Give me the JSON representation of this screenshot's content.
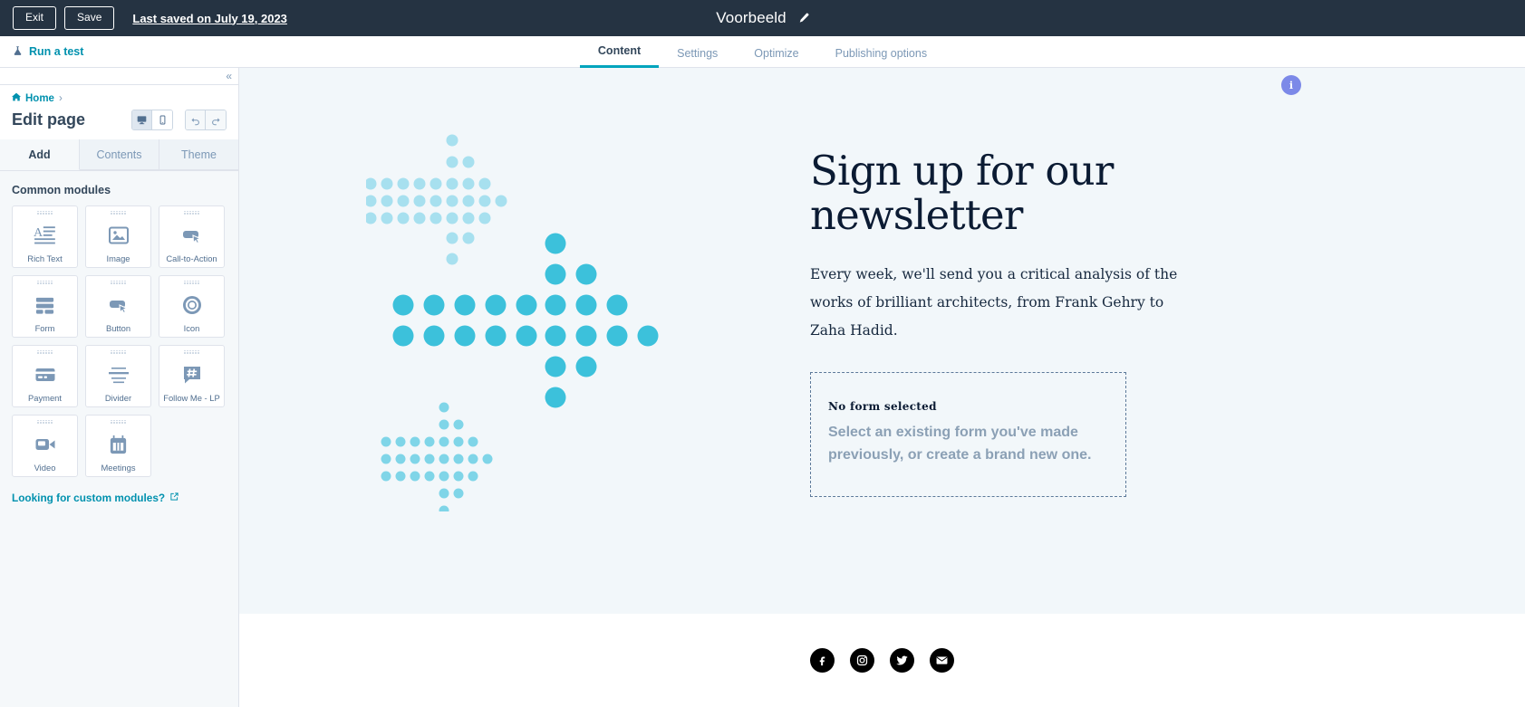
{
  "topbar": {
    "exit_label": "Exit",
    "save_label": "Save",
    "last_saved": "Last saved on July 19, 2023",
    "title": "Voorbeeld",
    "edit_icon": "pencil-icon"
  },
  "navbar": {
    "run_test": "Run a test",
    "run_test_icon": "flask-icon",
    "tabs": [
      {
        "label": "Content",
        "active": true
      },
      {
        "label": "Settings",
        "active": false
      },
      {
        "label": "Optimize",
        "active": false
      },
      {
        "label": "Publishing options",
        "active": false
      }
    ]
  },
  "sidebar": {
    "collapse_icon": "chevron-double-left-icon",
    "breadcrumb": {
      "home": "Home",
      "separator": "›",
      "home_icon": "home-icon"
    },
    "title": "Edit page",
    "view_toggle": [
      {
        "name": "desktop-view",
        "icon": "desktop-icon",
        "active": true
      },
      {
        "name": "mobile-view",
        "icon": "mobile-icon",
        "active": false
      }
    ],
    "history": [
      {
        "name": "undo-button",
        "icon": "undo-arrow-icon"
      },
      {
        "name": "redo-button",
        "icon": "redo-arrow-icon"
      }
    ],
    "tabs": [
      {
        "label": "Add",
        "active": true
      },
      {
        "label": "Contents",
        "active": false
      },
      {
        "label": "Theme",
        "active": false
      }
    ],
    "section_title": "Common modules",
    "modules": [
      {
        "label": "Rich Text",
        "icon": "rich-text-icon"
      },
      {
        "label": "Image",
        "icon": "image-icon"
      },
      {
        "label": "Call-to-Action",
        "icon": "cta-button-cursor-icon"
      },
      {
        "label": "Form",
        "icon": "form-icon"
      },
      {
        "label": "Button",
        "icon": "button-cursor-icon"
      },
      {
        "label": "Icon",
        "icon": "circle-badge-icon"
      },
      {
        "label": "Payment",
        "icon": "credit-card-icon"
      },
      {
        "label": "Divider",
        "icon": "divider-lines-icon"
      },
      {
        "label": "Follow Me - LP",
        "icon": "hashtag-speech-bubble-icon"
      },
      {
        "label": "Video",
        "icon": "video-camera-icon"
      },
      {
        "label": "Meetings",
        "icon": "calendar-icon"
      }
    ],
    "custom_modules_link": "Looking for custom modules?",
    "custom_modules_icon": "external-link-icon"
  },
  "canvas": {
    "headline": "Sign up for our newsletter",
    "paragraph": "Every week, we'll send you a critical analysis of the works of brilliant architects, from Frank Gehry to Zaha Hadid.",
    "info_badge": "i",
    "form_placeholder": {
      "title": "No form selected",
      "subtitle": "Select an existing form you've made previously, or create a brand new one."
    },
    "social": [
      {
        "name": "facebook-icon",
        "label": "f"
      },
      {
        "name": "instagram-icon",
        "label": "instagram"
      },
      {
        "name": "twitter-icon",
        "label": "twitter"
      },
      {
        "name": "email-icon",
        "label": "email"
      }
    ],
    "colors": {
      "hero_background": "#f2f7fa",
      "dot_light": "#a7e0ef",
      "dot_dark": "#3cc1db",
      "headline": "#0b1b33",
      "badge": "#7c89e8"
    }
  }
}
